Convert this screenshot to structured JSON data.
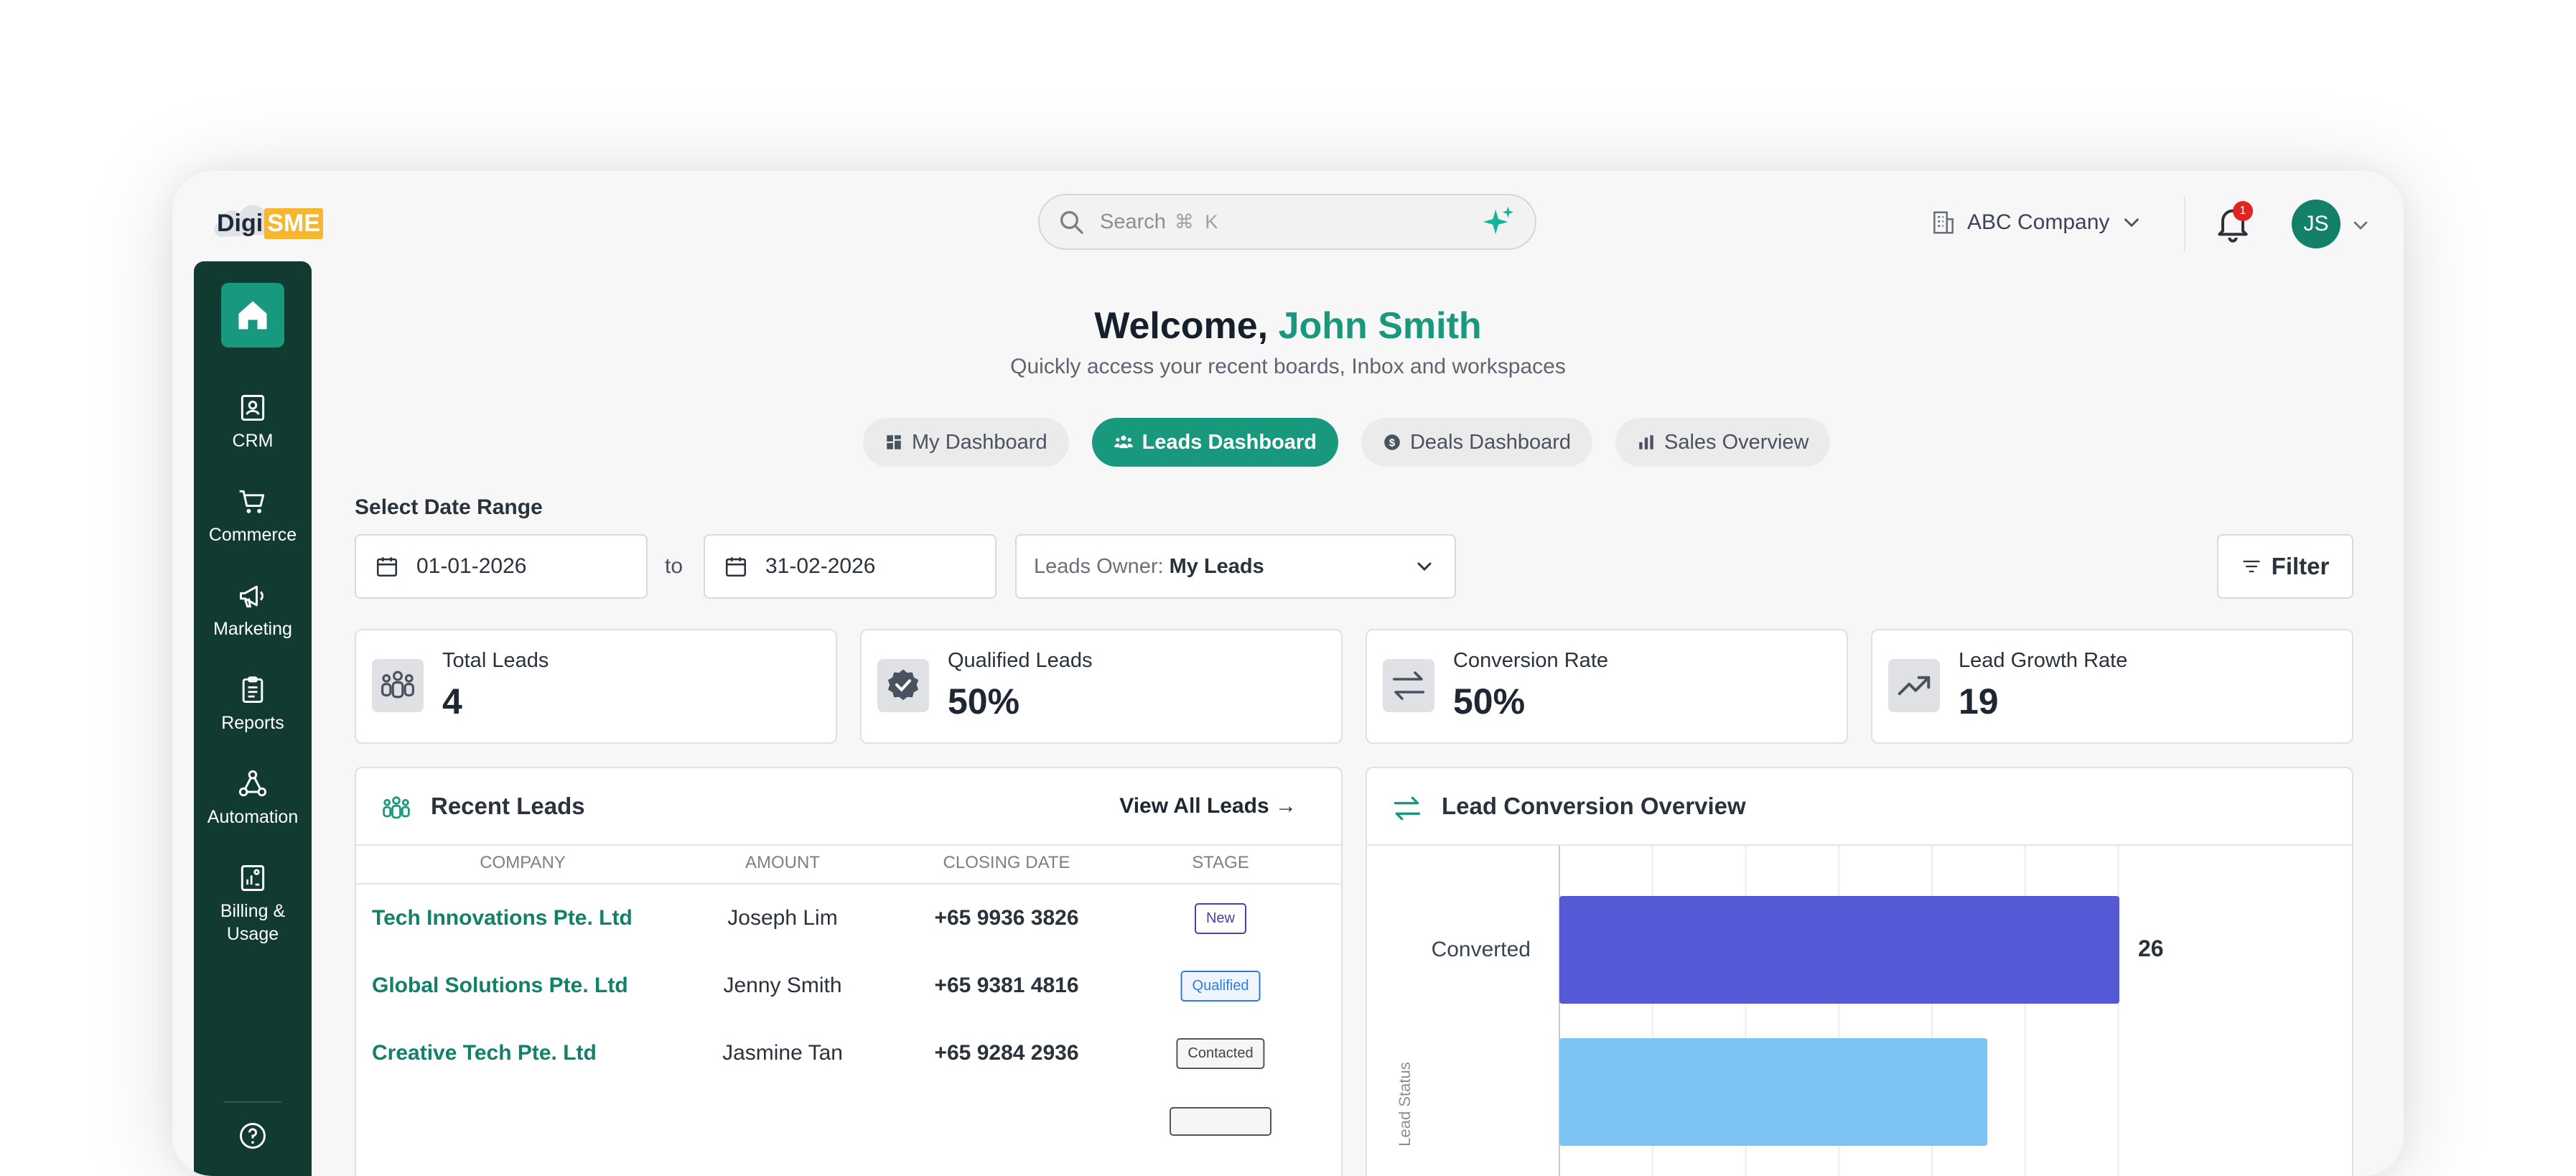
{
  "header": {
    "logo_text": "DigiSME",
    "logo_prefix": "Digi",
    "logo_suffix": "SME",
    "search_placeholder": "Search",
    "search_shortcut": "⌘ K",
    "company": "ABC Company",
    "notification_count": "1",
    "user_initials": "JS"
  },
  "sidebar": {
    "items": [
      {
        "label": "CRM",
        "icon": "contact-card-icon"
      },
      {
        "label": "Commerce",
        "icon": "cart-icon"
      },
      {
        "label": "Marketing",
        "icon": "megaphone-icon"
      },
      {
        "label": "Reports",
        "icon": "clipboard-icon"
      },
      {
        "label": "Automation",
        "icon": "workflow-icon"
      },
      {
        "label": "Billing &\nUsage",
        "label_line1": "Billing &",
        "label_line2": "Usage",
        "icon": "billing-icon"
      }
    ]
  },
  "welcome": {
    "greeting": "Welcome,",
    "name": "John Smith",
    "subtitle": "Quickly access your recent boards, Inbox and workspaces"
  },
  "tabs": [
    {
      "label": "My Dashboard",
      "active": false
    },
    {
      "label": "Leads Dashboard",
      "active": true
    },
    {
      "label": "Deals Dashboard",
      "active": false
    },
    {
      "label": "Sales Overview",
      "active": false
    }
  ],
  "filters": {
    "date_range_label": "Select Date Range",
    "start_date": "01-01-2026",
    "to": "to",
    "end_date": "31-02-2026",
    "owner_label": "Leads Owner:",
    "owner_value": "My Leads",
    "filter_button": "Filter"
  },
  "stats": [
    {
      "title": "Total Leads",
      "value": "4"
    },
    {
      "title": "Qualified Leads",
      "value": "50%"
    },
    {
      "title": "Conversion Rate",
      "value": "50%"
    },
    {
      "title": "Lead Growth Rate",
      "value": "19"
    }
  ],
  "recent_leads": {
    "title": "Recent Leads",
    "view_all": "View All Leads →",
    "columns": [
      "COMPANY",
      "AMOUNT",
      "CLOSING DATE",
      "STAGE"
    ],
    "rows": [
      {
        "company": "Tech Innovations Pte. Ltd",
        "amount": "Joseph Lim",
        "closing_date": "+65 9936 3826",
        "stage": "New"
      },
      {
        "company": "Global Solutions Pte. Ltd",
        "amount": "Jenny Smith",
        "closing_date": "+65 9381 4816",
        "stage": "Qualified"
      },
      {
        "company": "Creative Tech Pte. Ltd",
        "amount": "Jasmine Tan",
        "closing_date": "+65 9284 2936",
        "stage": "Contacted"
      }
    ]
  },
  "lead_conversion": {
    "title": "Lead Conversion Overview"
  },
  "chart_data": {
    "type": "bar",
    "orientation": "horizontal",
    "categories": [
      "Converted",
      ""
    ],
    "values": [
      26,
      null
    ],
    "title": "Lead Conversion Overview",
    "xlabel": "",
    "ylabel": "Lead Status",
    "xlim": [
      0,
      30
    ],
    "grid": true,
    "colors": [
      "#5559d6",
      "#7cc4f4"
    ],
    "note_second_bar_fraction": 0.69
  },
  "colors": {
    "brand": "#18987c",
    "sidebar": "#113a30",
    "accent_bar": "#5559d6"
  }
}
